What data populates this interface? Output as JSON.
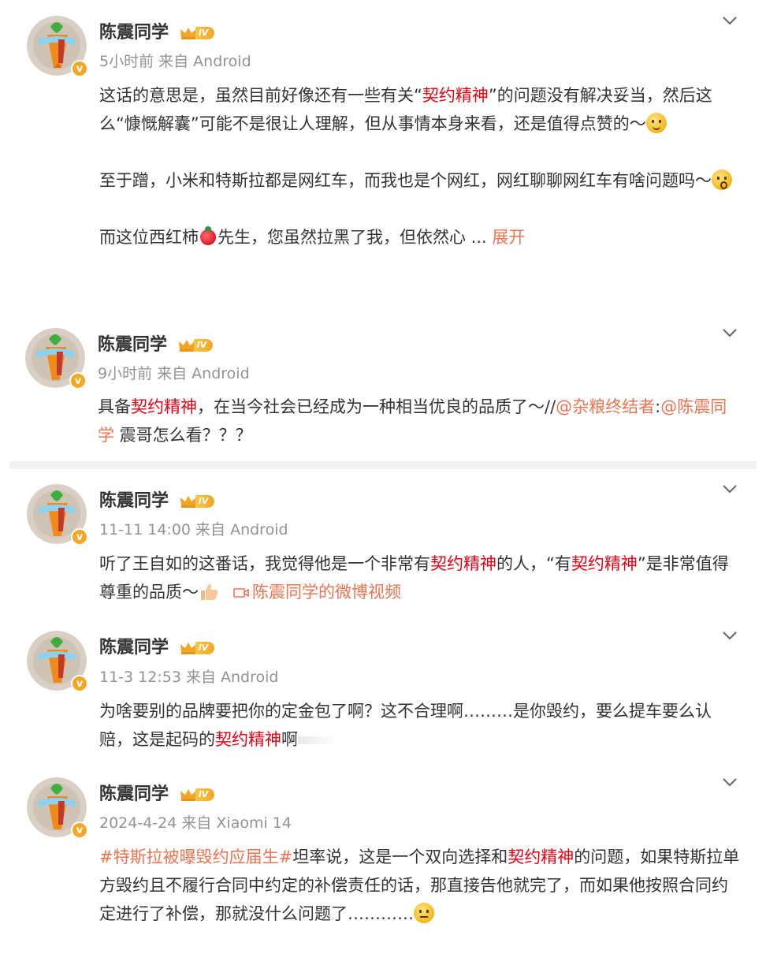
{
  "user": {
    "name": "陈震同学",
    "level": "IV",
    "badge": "v"
  },
  "posts": [
    {
      "meta": "5小时前 来自 Android",
      "p1": [
        "这话的意思是，虽然目前好像还有一些有关“",
        "契约精神",
        "”的问题没有解决妥当，然后这么“慷慨解囊”可能不是很让人理解，但从事情本身来看，还是值得点赞的～"
      ],
      "p2": [
        "至于蹭，小米和特斯拉都是网红车，而我也是个网红，网红聊聊网红车有啥问题吗～"
      ],
      "p3": [
        "而这位西红柿",
        "先生，您虽然拉黑了我，但依然心",
        " ... ",
        "展开"
      ]
    },
    {
      "meta": "9小时前 来自 Android",
      "parts": [
        "具备",
        "契约精神",
        "，在当今社会已经成为一种相当优良的品质了～//",
        "@杂粮终结者",
        ":",
        "@陈震同学",
        " 震哥怎么看？？？"
      ]
    },
    {
      "meta": "11-11 14:00 来自 Android",
      "parts": [
        "听了王自如的这番话，我觉得他是一个非常有",
        "契约精神",
        "的人，“有",
        "契约精神",
        "”是非常值得尊重的品质～",
        "陈震同学的微博视频"
      ]
    },
    {
      "meta": "11-3 12:53 来自 Android",
      "parts": [
        "为啥要别的品牌要把你的定金包了啊？这不合理啊………是你毁约，要么提车要么认赔，这是起码的",
        "契约精神",
        "啊"
      ]
    },
    {
      "meta": "2024-4-24 来自 Xiaomi 14",
      "parts": [
        "#特斯拉被曝毁约应届生#",
        "坦率说，这是一个双向选择和",
        "契约精神",
        "的问题，如果特斯拉单方毁约且不履行合同中约定的补偿责任的话，那直接告他就完了，而如果他按照合同约定进行了补偿，那就没什么问题了…………"
      ]
    }
  ],
  "colors": {
    "keyword": "#e60012",
    "link": "#eb7350",
    "meta": "#939393",
    "badge": "#f5a623"
  },
  "icons": [
    "avatar-carrot",
    "verified-badge",
    "crown-icon",
    "chevron-down-icon",
    "smile-emoji",
    "surprise-emoji",
    "thumbs-up-emoji",
    "think-emoji",
    "tomato-emoji",
    "video-icon"
  ]
}
